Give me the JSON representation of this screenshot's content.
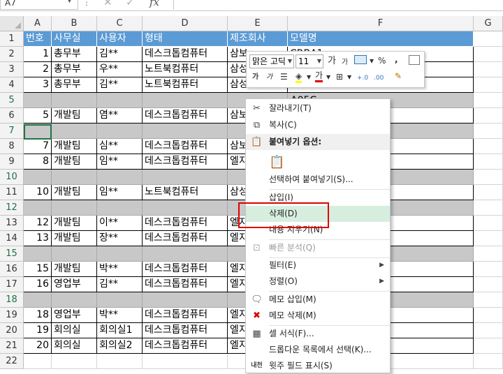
{
  "formula_bar": {
    "name_box": "A7",
    "cancel_icon": "close-icon",
    "enter_icon": "check-icon",
    "fx_label": "fx"
  },
  "columns": [
    {
      "label": "A"
    },
    {
      "label": "B"
    },
    {
      "label": "C"
    },
    {
      "label": "D"
    },
    {
      "label": "E"
    },
    {
      "label": "F"
    },
    {
      "label": "G"
    }
  ],
  "rows": [
    {
      "num": "1",
      "type": "header",
      "cells": [
        "번호",
        "사무실",
        "사용자",
        "형태",
        "제조회사",
        "모델명",
        ""
      ]
    },
    {
      "num": "2",
      "type": "data",
      "cells": [
        "1",
        "총무부",
        "김**",
        "데스크톱컴퓨터",
        "삼보",
        "CRBA1",
        ""
      ]
    },
    {
      "num": "3",
      "type": "data",
      "cells": [
        "2",
        "총무부",
        "우**",
        "노트북컴퓨터",
        "삼성",
        "",
        ""
      ]
    },
    {
      "num": "4",
      "type": "data",
      "cells": [
        "3",
        "총무부",
        "김**",
        "노트북컴퓨터",
        "삼성전자",
        "",
        ""
      ]
    },
    {
      "num": "5",
      "type": "gray",
      "cells": [
        "",
        "",
        "",
        "",
        "",
        "",
        ""
      ]
    },
    {
      "num": "6",
      "type": "data",
      "cells": [
        "5",
        "개발팀",
        "염**",
        "데스크톱컴퓨터",
        "삼보",
        "",
        ""
      ]
    },
    {
      "num": "7",
      "type": "gray",
      "cells": [
        "",
        "",
        "",
        "",
        "",
        "",
        ""
      ]
    },
    {
      "num": "8",
      "type": "data",
      "cells": [
        "7",
        "개발팀",
        "심**",
        "데스크톱컴퓨터",
        "삼보",
        "",
        ""
      ]
    },
    {
      "num": "9",
      "type": "data",
      "cells": [
        "8",
        "개발팀",
        "임**",
        "데스크톱컴퓨터",
        "엘지",
        "",
        ""
      ]
    },
    {
      "num": "10",
      "type": "gray",
      "cells": [
        "",
        "",
        "",
        "",
        "",
        "",
        ""
      ]
    },
    {
      "num": "11",
      "type": "data",
      "cells": [
        "10",
        "개발팀",
        "임**",
        "노트북컴퓨터",
        "삼성",
        "",
        ""
      ]
    },
    {
      "num": "12",
      "type": "gray",
      "cells": [
        "",
        "",
        "",
        "",
        "",
        "",
        ""
      ]
    },
    {
      "num": "13",
      "type": "data",
      "cells": [
        "12",
        "개발팀",
        "이**",
        "데스크톱컴퓨터",
        "엘지",
        "",
        ""
      ]
    },
    {
      "num": "14",
      "type": "data",
      "cells": [
        "13",
        "개발팀",
        "장**",
        "데스크톱컴퓨터",
        "엘지",
        "",
        ""
      ]
    },
    {
      "num": "15",
      "type": "gray",
      "cells": [
        "",
        "",
        "",
        "",
        "",
        "",
        ""
      ]
    },
    {
      "num": "16",
      "type": "data",
      "cells": [
        "15",
        "개발팀",
        "박**",
        "데스크톱컴퓨터",
        "엘지",
        "",
        ""
      ]
    },
    {
      "num": "17",
      "type": "data",
      "cells": [
        "16",
        "영업부",
        "김**",
        "데스크톱컴퓨터",
        "엘지",
        "",
        ""
      ]
    },
    {
      "num": "18",
      "type": "gray",
      "cells": [
        "",
        "",
        "",
        "",
        "",
        "",
        ""
      ]
    },
    {
      "num": "19",
      "type": "data",
      "cells": [
        "18",
        "영업부",
        "박**",
        "데스크톱컴퓨터",
        "엘지",
        "",
        ""
      ]
    },
    {
      "num": "20",
      "type": "data",
      "cells": [
        "19",
        "회의실",
        "회의실1",
        "데스크톱컴퓨터",
        "엘지",
        "",
        ""
      ]
    },
    {
      "num": "21",
      "type": "data",
      "cells": [
        "20",
        "회의실",
        "회의실2",
        "데스크톱컴퓨터",
        "엘지",
        "",
        ""
      ]
    },
    {
      "num": "22",
      "type": "blank",
      "cells": [
        "",
        "",
        "",
        "",
        "",
        "",
        ""
      ]
    }
  ],
  "partial_text": {
    "f4": "CAV172UD52-A05C"
  },
  "mini_toolbar": {
    "font_name": "맑은 고딕",
    "font_size": "11",
    "grow_font": "가",
    "shrink_font": "가",
    "percent": "%",
    "comma": ",",
    "bold": "가",
    "italic": "가",
    "font_color_glyph": "가",
    "decimal_increase": "+.0",
    "decimal_decrease": ".00"
  },
  "context_menu": {
    "items": [
      {
        "label": "잘라내기(T)",
        "icon": "scissors-icon"
      },
      {
        "label": "복사(C)",
        "icon": "copy-icon"
      },
      {
        "label": "붙여넣기 옵션:",
        "icon": "paste-icon"
      },
      {
        "label": "선택하여 붙여넣기(S)...",
        "icon": ""
      },
      {
        "label": "삽입(I)",
        "icon": ""
      },
      {
        "label": "삭제(D)",
        "icon": ""
      },
      {
        "label": "내용 지우기(N)",
        "icon": ""
      },
      {
        "label": "빠른 분석(Q)",
        "icon": "quick-analysis-icon"
      },
      {
        "label": "필터(E)",
        "icon": ""
      },
      {
        "label": "정렬(O)",
        "icon": ""
      },
      {
        "label": "메모 삽입(M)",
        "icon": "insert-comment-icon"
      },
      {
        "label": "메모 삭제(M)",
        "icon": "delete-comment-icon"
      },
      {
        "label": "셀 서식(F)...",
        "icon": "format-cells-icon"
      },
      {
        "label": "드롭다운 목록에서 선택(K)...",
        "icon": ""
      },
      {
        "label": "윗주 필드 표시(S)",
        "icon": "phonetic-icon"
      }
    ]
  },
  "colors": {
    "header_fill": "#5b9bd5",
    "gray_row": "#c8c8c8",
    "highlight": "#d7eedf",
    "callout": "#e00000",
    "active_border": "#217346"
  }
}
